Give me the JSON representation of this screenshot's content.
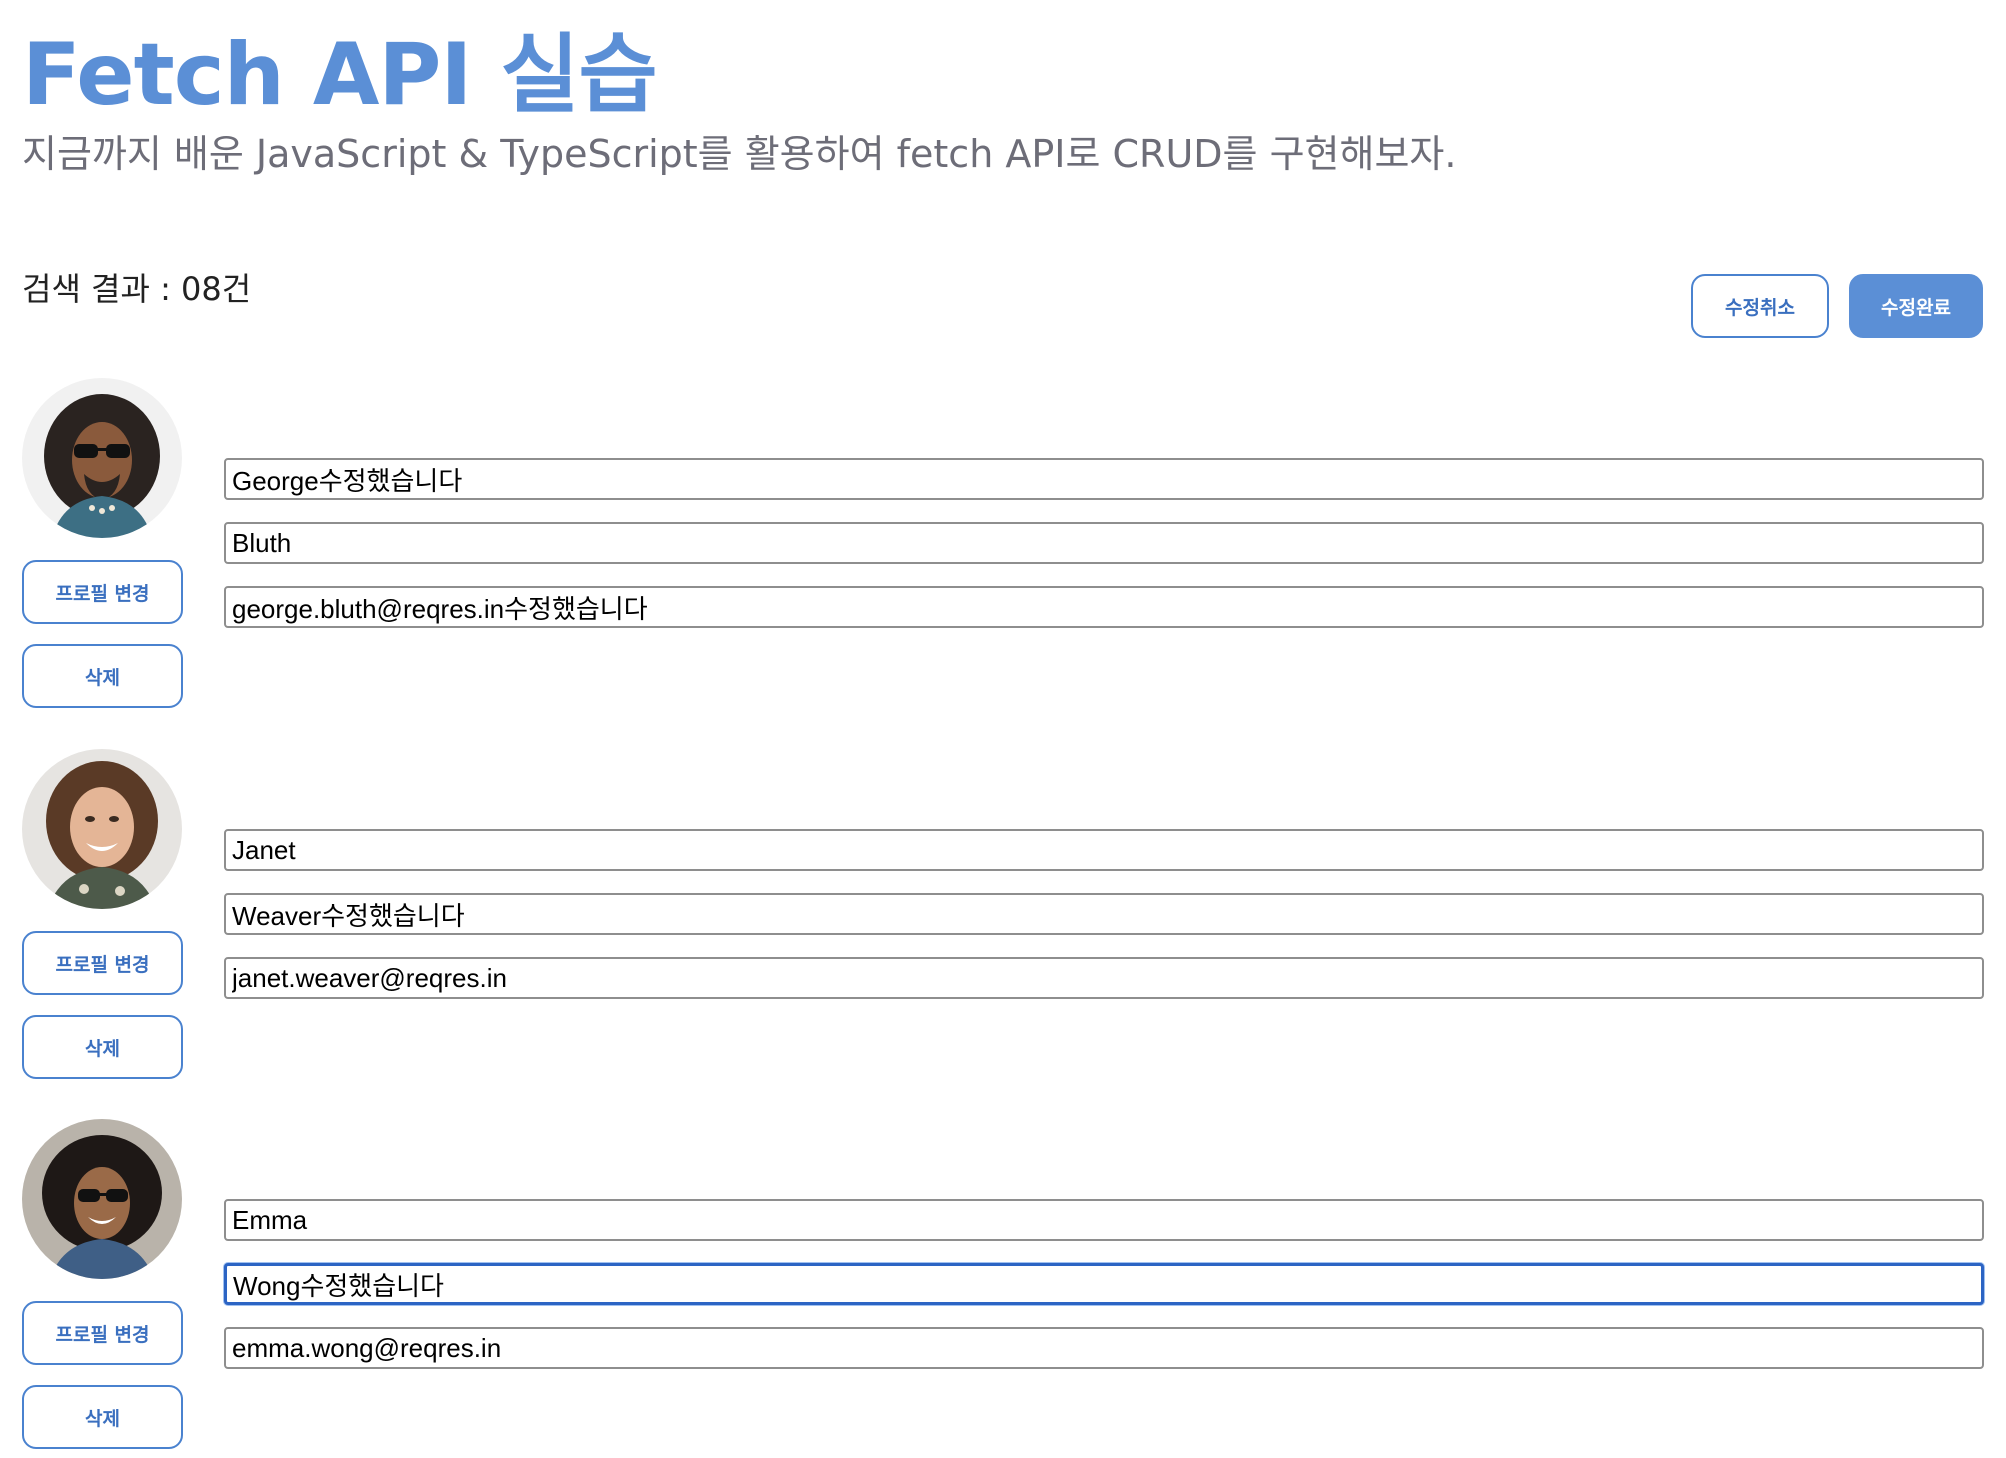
{
  "header": {
    "title": "Fetch API 실습",
    "subtitle": "지금까지 배운 JavaScript & TypeScript를 활용하여 fetch API로 CRUD를 구현해보자."
  },
  "toolbar": {
    "result_count": "검색 결과 : 08건",
    "cancel_label": "수정취소",
    "done_label": "수정완료"
  },
  "users": [
    {
      "first_name": "George수정했습니다",
      "last_name": "Bluth",
      "email": "george.bluth@reqres.in수정했습니다",
      "profile_label": "프로필 변경",
      "delete_label": "삭제"
    },
    {
      "first_name": "Janet",
      "last_name": "Weaver수정했습니다",
      "email": "janet.weaver@reqres.in",
      "profile_label": "프로필 변경",
      "delete_label": "삭제"
    },
    {
      "first_name": "Emma",
      "last_name": "Wong수정했습니다",
      "email": "emma.wong@reqres.in",
      "profile_label": "프로필 변경",
      "delete_label": "삭제"
    }
  ],
  "colors": {
    "accent": "#5b8fd6",
    "focus_border": "#2c64c4"
  }
}
